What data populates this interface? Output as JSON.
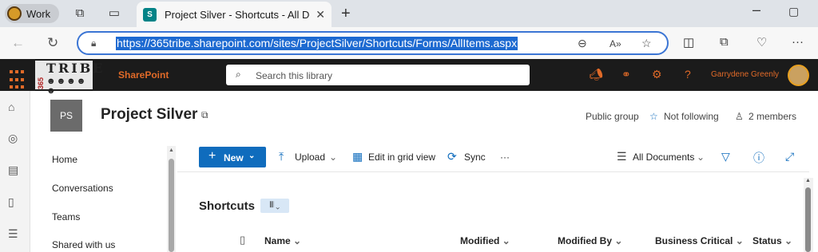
{
  "browser": {
    "profile_label": "Work",
    "tab_title": "Project Silver - Shortcuts - All Doc",
    "url": "https://365tribe.sharepoint.com/sites/ProjectSilver/Shortcuts/Forms/AllItems.aspx"
  },
  "suite": {
    "logo_number": "365",
    "logo_text": "TRIBE",
    "app_name": "SharePoint",
    "search_placeholder": "Search this library",
    "user_name": "Garrydene Greenly"
  },
  "site": {
    "initials": "PS",
    "title": "Project Silver",
    "visibility": "Public group",
    "follow_label": "Not following",
    "members_label": "2 members"
  },
  "left_nav": {
    "items": [
      "Home",
      "Conversations",
      "Teams",
      "Shared with us"
    ]
  },
  "command_bar": {
    "new_label": "New",
    "upload_label": "Upload",
    "grid_label": "Edit in grid view",
    "sync_label": "Sync",
    "more_label": "···",
    "view_label": "All Documents"
  },
  "library": {
    "title": "Shortcuts",
    "columns": [
      "Name",
      "Modified",
      "Modified By",
      "Business Critical",
      "Status"
    ]
  },
  "colors": {
    "accent": "#0f6cbd",
    "suite_bar": "#1b1b1b",
    "suite_accent": "#e06a28",
    "url_selection": "#1d6ad1"
  }
}
